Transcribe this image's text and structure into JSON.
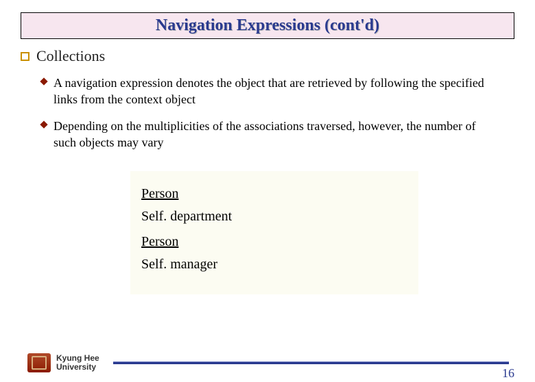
{
  "title": "Navigation Expressions (cont'd)",
  "heading": "Collections",
  "bullets": [
    "A navigation expression denotes the object that are retrieved by following the specified links from the context object",
    "Depending on the multiplicities of the associations traversed, however, the number of such objects may vary"
  ],
  "code": {
    "context1": "Person",
    "expr1": "Self. department",
    "context2": "Person",
    "expr2": "Self. manager"
  },
  "footer": {
    "line1": "Kyung Hee",
    "line2": "University"
  },
  "page_number": "16"
}
